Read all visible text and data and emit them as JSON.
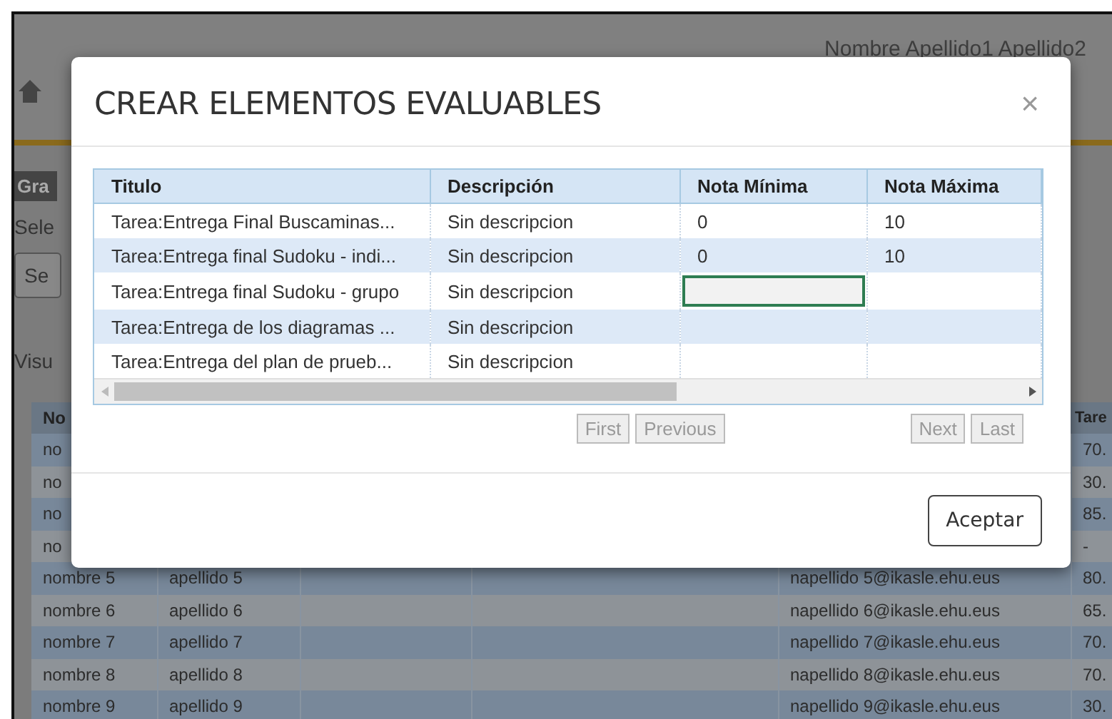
{
  "header": {
    "user_name": "Nombre Apellido1 Apellido2"
  },
  "page": {
    "button_1": "Gra",
    "label_1": "Sele",
    "button_2": "Se",
    "label_2": "Visu"
  },
  "table": {
    "columns": [
      "No",
      "Tare"
    ],
    "rows": [
      {
        "name": "no",
        "value": "70."
      },
      {
        "name": "no",
        "value": "30."
      },
      {
        "name": "no",
        "value": "85."
      },
      {
        "name": "no",
        "value": "-"
      },
      {
        "name": "nombre 5",
        "surname": "apellido 5",
        "email": "napellido 5@ikasle.ehu.eus",
        "value": "80."
      },
      {
        "name": "nombre 6",
        "surname": "apellido 6",
        "email": "napellido 6@ikasle.ehu.eus",
        "value": "65."
      },
      {
        "name": "nombre 7",
        "surname": "apellido 7",
        "email": "napellido 7@ikasle.ehu.eus",
        "value": "70."
      },
      {
        "name": "nombre 8",
        "surname": "apellido 8",
        "email": "napellido 8@ikasle.ehu.eus",
        "value": "70."
      },
      {
        "name": "nombre 9",
        "surname": "apellido 9",
        "email": "napellido 9@ikasle.ehu.eus",
        "value": "30."
      }
    ]
  },
  "dialog": {
    "title": "CREAR ELEMENTOS EVALUABLES",
    "close": "×",
    "columns": [
      "Titulo",
      "Descripción",
      "Nota Mínima",
      "Nota Máxima"
    ],
    "rows": [
      {
        "titulo": "Tarea:Entrega Final Buscaminas...",
        "descripcion": "Sin descripcion",
        "nota_minima": "0",
        "nota_maxima": "10",
        "editing": false
      },
      {
        "titulo": "Tarea:Entrega final Sudoku - indi...",
        "descripcion": "Sin descripcion",
        "nota_minima": "0",
        "nota_maxima": "10",
        "editing": false
      },
      {
        "titulo": "Tarea:Entrega final Sudoku - grupo",
        "descripcion": "Sin descripcion",
        "editing": true
      },
      {
        "titulo": "Tarea:Entrega de los diagramas ...",
        "descripcion": "Sin descripcion",
        "editing": false
      },
      {
        "titulo": "Tarea:Entrega del plan de prueb...",
        "descripcion": "Sin descripcion",
        "editing": false
      }
    ],
    "pager": [
      {
        "label": "First",
        "disabled": true
      },
      {
        "label": "Previous",
        "disabled": true
      },
      {
        "label": "Next",
        "disabled": true
      },
      {
        "label": "Last",
        "disabled": true
      }
    ],
    "accept": "Aceptar"
  }
}
